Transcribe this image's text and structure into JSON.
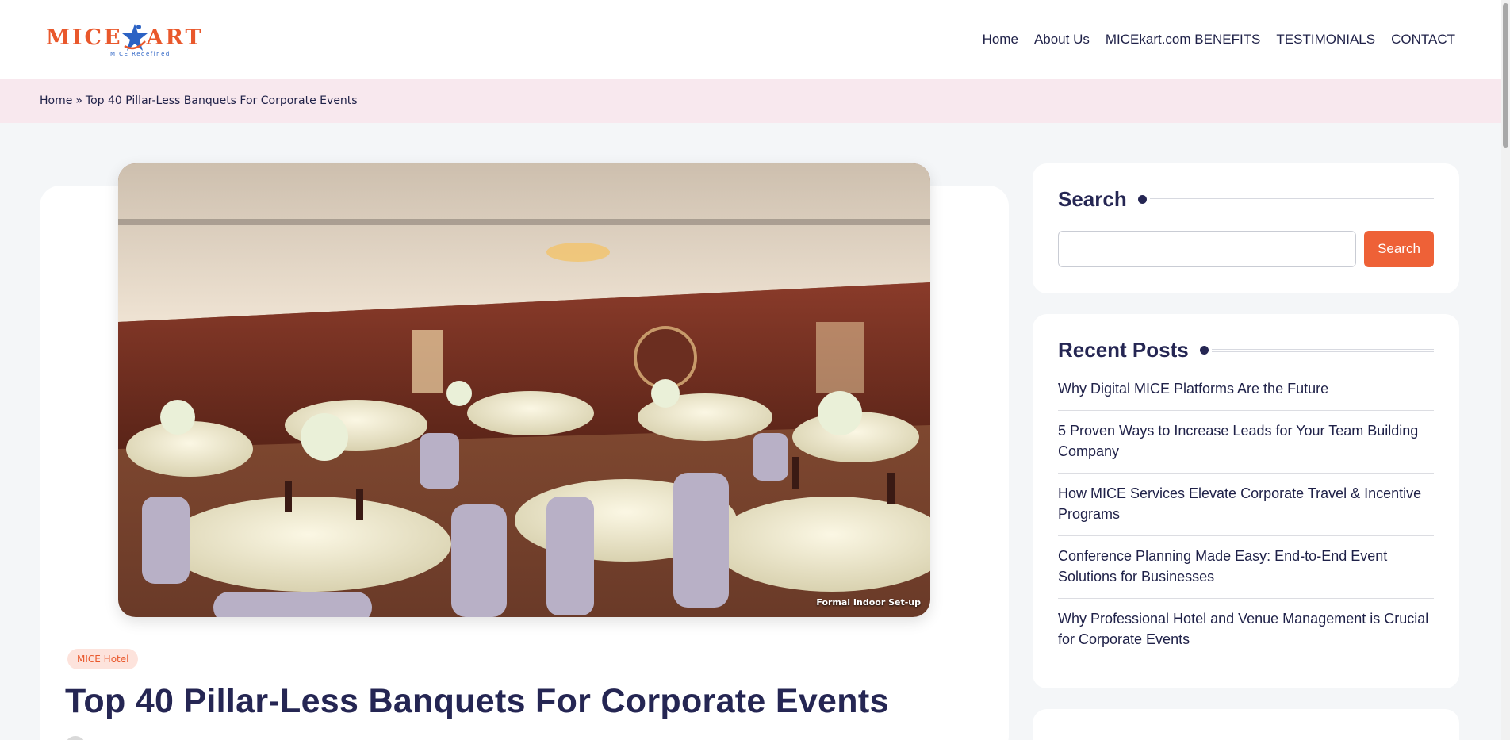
{
  "brand": {
    "logo_text_left": "MICE",
    "logo_text_right": "ART",
    "logo_tagline": "MICE Redefined",
    "accent_color": "#e9582c",
    "text_color": "#252653"
  },
  "nav": {
    "items": [
      {
        "label": "Home"
      },
      {
        "label": "About Us"
      },
      {
        "label": "MICEkart.com BENEFITS"
      },
      {
        "label": "TESTIMONIALS"
      },
      {
        "label": "CONTACT"
      }
    ]
  },
  "breadcrumb": {
    "home": "Home",
    "separator": "»",
    "current": "Top 40 Pillar-Less Banquets For Corporate Events"
  },
  "article": {
    "image_caption": "Formal Indoor Set-up",
    "category": "MICE Hotel",
    "title": "Top 40 Pillar-Less Banquets For Corporate Events"
  },
  "sidebar": {
    "search": {
      "title": "Search",
      "input_value": "",
      "button_label": "Search"
    },
    "recent_posts": {
      "title": "Recent Posts",
      "items": [
        {
          "label": "Why Digital MICE Platforms Are the Future"
        },
        {
          "label": "5 Proven Ways to Increase Leads for Your Team Building Company"
        },
        {
          "label": "How MICE Services Elevate Corporate Travel & Incentive Programs"
        },
        {
          "label": "Conference Planning Made Easy: End-to-End Event Solutions for Businesses"
        },
        {
          "label": "Why Professional Hotel and Venue Management is Crucial for Corporate Events"
        }
      ]
    }
  }
}
